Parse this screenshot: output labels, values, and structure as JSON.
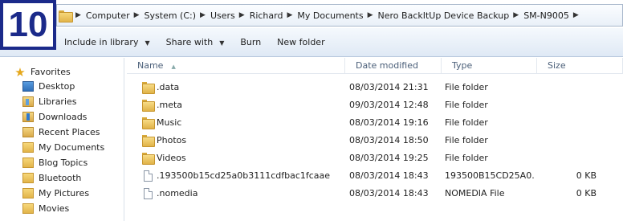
{
  "badge": {
    "number": "10"
  },
  "address": {
    "crumbs": [
      "Computer",
      "System (C:)",
      "Users",
      "Richard",
      "My Documents",
      "Nero BackItUp Device Backup",
      "SM-N9005"
    ]
  },
  "toolbar": {
    "include_label": "Include in library",
    "share_label": "Share with",
    "burn_label": "Burn",
    "new_folder_label": "New folder"
  },
  "nav": {
    "favorites": "Favorites",
    "items": [
      "Desktop",
      "Libraries",
      "Downloads",
      "Recent Places",
      "My Documents",
      "Blog Topics",
      "Bluetooth",
      "My Pictures",
      "Movies"
    ]
  },
  "columns": {
    "name": "Name",
    "date": "Date modified",
    "type": "Type",
    "size": "Size"
  },
  "files": [
    {
      "name": ".data",
      "date": "08/03/2014 21:31",
      "type": "File folder",
      "size": "",
      "icon": "folder"
    },
    {
      "name": ".meta",
      "date": "09/03/2014 12:48",
      "type": "File folder",
      "size": "",
      "icon": "folder"
    },
    {
      "name": "Music",
      "date": "08/03/2014 19:16",
      "type": "File folder",
      "size": "",
      "icon": "folder"
    },
    {
      "name": "Photos",
      "date": "08/03/2014 18:50",
      "type": "File folder",
      "size": "",
      "icon": "folder"
    },
    {
      "name": "Videos",
      "date": "08/03/2014 19:25",
      "type": "File folder",
      "size": "",
      "icon": "folder"
    },
    {
      "name": ".193500b15cd25a0b3111cdfbac1fcaae",
      "date": "08/03/2014 18:43",
      "type": "193500B15CD25A0...",
      "size": "0 KB",
      "icon": "file"
    },
    {
      "name": ".nomedia",
      "date": "08/03/2014 18:43",
      "type": "NOMEDIA File",
      "size": "0 KB",
      "icon": "file"
    }
  ]
}
